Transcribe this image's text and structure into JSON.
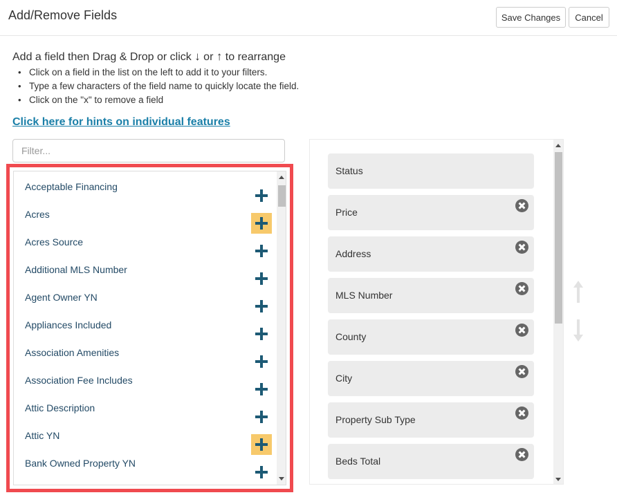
{
  "header": {
    "title": "Add/Remove Fields",
    "save_label": "Save Changes",
    "cancel_label": "Cancel"
  },
  "instructions": {
    "lead_before": "Add a field then Drag & Drop or click ",
    "down_glyph": "↓",
    "or_text": " or ",
    "up_glyph": "↑",
    "lead_after": " to rearrange",
    "bullets": [
      "Click on a field in the list on the left to add it to your filters.",
      "Type a few characters of the field name to quickly locate the field.",
      "Click on the \"x\" to remove a field"
    ]
  },
  "hints_link": "Click here for hints on individual features",
  "filter": {
    "placeholder": "Filter...",
    "value": ""
  },
  "available_fields": [
    {
      "label": "Acceptable Financing",
      "highlighted": false
    },
    {
      "label": "Acres",
      "highlighted": true
    },
    {
      "label": "Acres Source",
      "highlighted": false
    },
    {
      "label": "Additional MLS Number",
      "highlighted": false
    },
    {
      "label": "Agent Owner YN",
      "highlighted": false
    },
    {
      "label": "Appliances Included",
      "highlighted": false
    },
    {
      "label": "Association Amenities",
      "highlighted": false
    },
    {
      "label": "Association Fee Includes",
      "highlighted": false
    },
    {
      "label": "Attic Description",
      "highlighted": false
    },
    {
      "label": "Attic YN",
      "highlighted": true
    },
    {
      "label": "Bank Owned Property YN",
      "highlighted": false
    }
  ],
  "selected_fields": [
    {
      "label": "Status",
      "removable": false
    },
    {
      "label": "Price",
      "removable": true
    },
    {
      "label": "Address",
      "removable": true
    },
    {
      "label": "MLS Number",
      "removable": true
    },
    {
      "label": "County",
      "removable": true
    },
    {
      "label": "City",
      "removable": true
    },
    {
      "label": "Property Sub Type",
      "removable": true
    },
    {
      "label": "Beds Total",
      "removable": true
    }
  ],
  "icons": {
    "add": "plus-icon",
    "remove": "remove-circle-x-icon",
    "move_up": "arrow-up-icon",
    "move_down": "arrow-down-icon"
  },
  "colors": {
    "add_icon": "#1d5a75",
    "highlight": "#f7c96b",
    "panel_outline": "#f04a4f",
    "link": "#1a7fa8",
    "field_text": "#234a66",
    "item_bg": "#ececec"
  }
}
